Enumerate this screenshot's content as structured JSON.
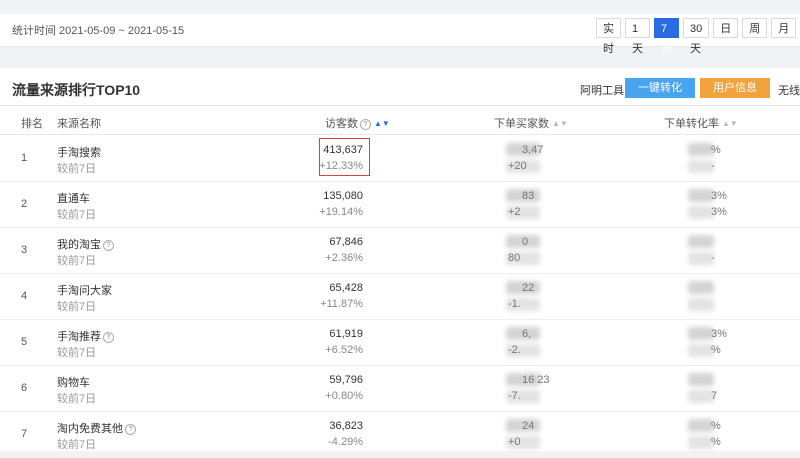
{
  "header": {
    "period": "统计时间 2021-05-09 ~ 2021-05-15",
    "ranges": [
      {
        "label": "实 时",
        "active": false
      },
      {
        "label": "1天",
        "active": false
      },
      {
        "label": "7天",
        "active": true
      },
      {
        "label": "30天",
        "active": false
      },
      {
        "label": "日",
        "active": false
      },
      {
        "label": "周",
        "active": false
      },
      {
        "label": "月",
        "active": false
      }
    ]
  },
  "panel": {
    "title": "流量来源排行TOP10",
    "tools_label": "阿明工具：",
    "convert_button": "一键转化",
    "user_info_button": "用户信息",
    "tools_more": "无线端"
  },
  "table": {
    "columns": {
      "rank": "排名",
      "source": "来源名称",
      "visitors": "访客数",
      "buyers": "下单买家数",
      "conversion": "下单转化率"
    },
    "rows": [
      {
        "rank": "1",
        "name": "手淘搜索",
        "help": false,
        "compare": "较前7日",
        "visitors": "413,637",
        "visitors_delta": "+12.33%",
        "buyers_top": "3,47",
        "buyers_bottom": "+20",
        "conv_top": "%",
        "conv_bottom": "-"
      },
      {
        "rank": "2",
        "name": "直通车",
        "help": false,
        "compare": "较前7日",
        "visitors": "135,080",
        "visitors_delta": "+19.14%",
        "buyers_top": "83",
        "buyers_bottom": "+2",
        "conv_top": "3%",
        "conv_bottom": "3%"
      },
      {
        "rank": "3",
        "name": "我的淘宝",
        "help": true,
        "compare": "较前7日",
        "visitors": "67,846",
        "visitors_delta": "+2.36%",
        "buyers_top": "0",
        "buyers_bottom": "80",
        "conv_top": "",
        "conv_bottom": "-"
      },
      {
        "rank": "4",
        "name": "手淘问大家",
        "help": false,
        "compare": "较前7日",
        "visitors": "65,428",
        "visitors_delta": "+11.87%",
        "buyers_top": "22",
        "buyers_bottom": "-1.",
        "conv_top": "",
        "conv_bottom": ""
      },
      {
        "rank": "5",
        "name": "手淘推荐",
        "help": true,
        "compare": "较前7日",
        "visitors": "61,919",
        "visitors_delta": "+6.52%",
        "buyers_top": "6,",
        "buyers_bottom": "-2.",
        "conv_top": "3%",
        "conv_bottom": "%"
      },
      {
        "rank": "6",
        "name": "购物车",
        "help": false,
        "compare": "较前7日",
        "visitors": "59,796",
        "visitors_delta": "+0.80%",
        "buyers_top": "16 23",
        "buyers_bottom": "-7.",
        "conv_top": "",
        "conv_bottom": "7"
      },
      {
        "rank": "7",
        "name": "淘内免费其他",
        "help": true,
        "compare": "较前7日",
        "visitors": "36,823",
        "visitors_delta": "-4.29%",
        "buyers_top": "24",
        "buyers_bottom": "+0",
        "conv_top": "%",
        "conv_bottom": "%"
      }
    ]
  },
  "colors": {
    "accent_blue": "#2b6be0",
    "button_blue": "#4aa3f0",
    "button_orange": "#f0a23c",
    "highlight_red": "#e23b3b"
  }
}
